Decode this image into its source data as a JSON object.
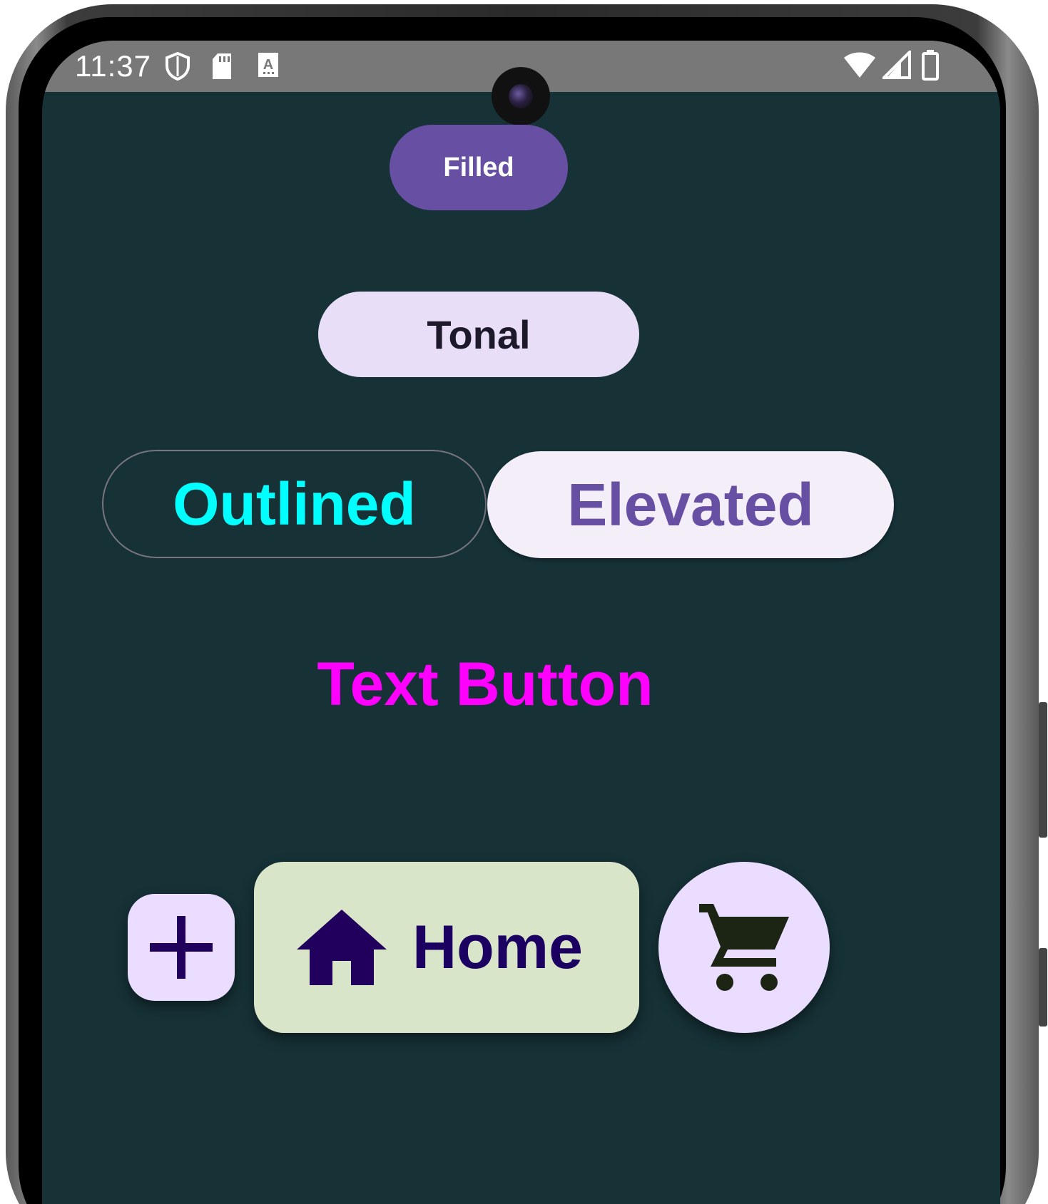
{
  "status_bar": {
    "time": "11:37",
    "left_icons": [
      "shield-icon",
      "sd-card-icon",
      "font-a-icon"
    ],
    "right_icons": [
      "wifi-icon",
      "cellular-signal-icon",
      "battery-icon"
    ]
  },
  "screen": {
    "background": "#163237"
  },
  "buttons": {
    "filled": {
      "label": "Filled",
      "bg": "#6750a4",
      "fg": "#ffffff"
    },
    "tonal": {
      "label": "Tonal",
      "bg": "#e8def8",
      "fg": "#1d192b"
    },
    "outlined": {
      "label": "Outlined",
      "fg": "#00ffff",
      "border": "#79747e"
    },
    "elevated": {
      "label": "Elevated",
      "bg": "#f3eef8",
      "fg": "#6750a4"
    },
    "text": {
      "label": "Text Button",
      "fg": "#ff00ff"
    }
  },
  "fabs": {
    "small": {
      "icon": "plus-icon",
      "bg": "#eaddff",
      "fg": "#21005d"
    },
    "extended": {
      "icon": "home-icon",
      "label": "Home",
      "bg": "#d8e5c8",
      "fg": "#1c0061"
    },
    "round": {
      "icon": "shopping-cart-icon",
      "bg": "#eaddff",
      "fg": "#1c2413"
    }
  }
}
